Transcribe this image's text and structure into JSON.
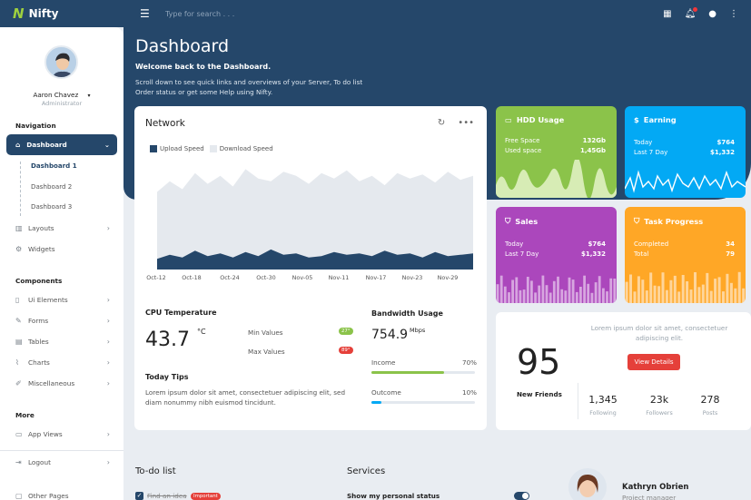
{
  "brand": {
    "name": "Nifty",
    "logo_mark": "N"
  },
  "topbar": {
    "search_placeholder": "Type for search . . ."
  },
  "sidebar": {
    "user_name": "Aaron Chavez",
    "user_role": "Administrator",
    "nav_heading": "Navigation",
    "dashboard": "Dashboard",
    "sub_items": [
      "Dashboard 1",
      "Dashboard 2",
      "Dashboard 3"
    ],
    "layouts": "Layouts",
    "widgets": "Widgets",
    "components_heading": "Components",
    "components": [
      "Ui Elements",
      "Forms",
      "Tables",
      "Charts",
      "Miscellaneous"
    ],
    "more_heading": "More",
    "app_views": "App Views",
    "logout": "Logout",
    "other_pages": "Other Pages"
  },
  "hero": {
    "title": "Dashboard",
    "welcome": "Welcome back to the Dashboard.",
    "desc_line1": "Scroll down to see quick links and overviews of your Server, To do list",
    "desc_line2": "Order status or get some Help using Nifty."
  },
  "network": {
    "title": "Network",
    "legend_upload": "Upload Speed",
    "legend_download": "Download Speed",
    "upload_color": "#25476a",
    "download_color": "#e5e9ee"
  },
  "chart_data": {
    "type": "area",
    "x": [
      "Oct-12",
      "Oct-18",
      "Oct-24",
      "Oct-30",
      "Nov-05",
      "Nov-11",
      "Nov-17",
      "Nov-23",
      "Nov-29"
    ],
    "series": [
      {
        "name": "Upload Speed",
        "values": [
          8,
          11,
          9,
          14,
          10,
          12,
          9,
          13,
          10,
          15,
          11,
          12,
          9,
          10,
          13,
          11,
          12,
          10,
          14,
          11,
          12,
          9,
          13,
          10,
          11,
          12
        ]
      },
      {
        "name": "Download Speed",
        "values": [
          58,
          66,
          60,
          72,
          64,
          70,
          62,
          75,
          68,
          66,
          73,
          70,
          64,
          72,
          68,
          74,
          66,
          70,
          63,
          72,
          68,
          71,
          65,
          73,
          67,
          70
        ]
      }
    ]
  },
  "cpu": {
    "heading": "CPU Temperature",
    "value": "43.7",
    "unit": "°C",
    "min_label": "Min Values",
    "min_badge": "27°",
    "max_label": "Max Values",
    "max_badge": "89°"
  },
  "tips": {
    "heading": "Today Tips",
    "text_line1": "Lorem ipsum dolor sit amet, consectetuer adipiscing elit, sed",
    "text_line2": "diam nonummy nibh euismod tincidunt."
  },
  "bandwidth": {
    "heading": "Bandwidth Usage",
    "value": "754.9",
    "unit": "Mbps",
    "income_label": "Income",
    "income_pct": "70%",
    "income_fill": 0.7,
    "outcome_label": "Outcome",
    "outcome_pct": "10%",
    "outcome_fill": 0.1
  },
  "tiles": {
    "hdd": {
      "title": "HDD Usage",
      "r1_label": "Free Space",
      "r1_value": "132Gb",
      "r2_label": "Used space",
      "r2_value": "1,45Gb",
      "color": "#8bc34a"
    },
    "earning": {
      "title": "Earning",
      "r1_label": "Today",
      "r1_value": "$764",
      "r2_label": "Last 7 Day",
      "r2_value": "$1,332",
      "color": "#03a9f4"
    },
    "sales": {
      "title": "Sales",
      "r1_label": "Today",
      "r1_value": "$764",
      "r2_label": "Last 7 Day",
      "r2_value": "$1,332",
      "color": "#ab47bc"
    },
    "task": {
      "title": "Task Progress",
      "r1_label": "Completed",
      "r1_value": "34",
      "r2_label": "Total",
      "r2_value": "79",
      "color": "#ffa726"
    }
  },
  "friends": {
    "count": "95",
    "label": "New Friends",
    "text_line1": "Lorem ipsum dolor sit amet, consectetuer",
    "text_line2": "adipiscing elit.",
    "button": "View Details",
    "following": "1,345",
    "following_label": "Following",
    "followers": "23k",
    "followers_label": "Followers",
    "posts": "278",
    "posts_label": "Posts"
  },
  "todo": {
    "heading": "To-do list",
    "first_item": "Find an idea",
    "badge": "Important"
  },
  "services": {
    "heading": "Services",
    "first_item": "Show my personal status"
  },
  "profile": {
    "name": "Kathryn Obrien",
    "role": "Project manager"
  }
}
